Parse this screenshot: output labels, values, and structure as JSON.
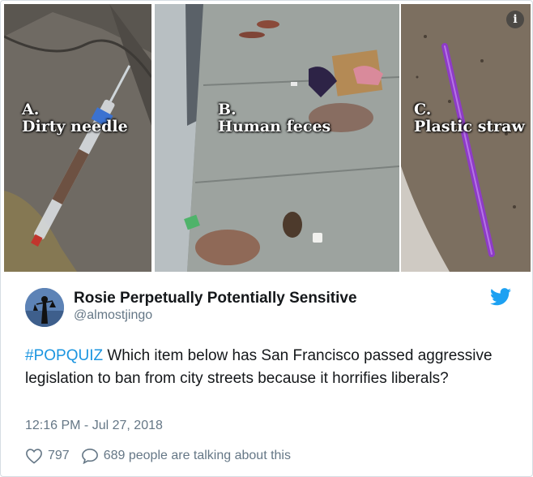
{
  "media": {
    "panels": [
      {
        "caption_letter": "A.",
        "caption_text": "Dirty needle"
      },
      {
        "caption_letter": "B.",
        "caption_text": "Human feces"
      },
      {
        "caption_letter": "C.",
        "caption_text": "Plastic straw"
      }
    ],
    "info_icon": "i"
  },
  "author": {
    "name": "Rosie Perpetually Potentially Sensitive",
    "handle": "@almostjingo"
  },
  "tweet": {
    "hashtag": "#POPQUIZ",
    "text": " Which item below has San Francisco passed aggressive legislation to ban from city streets because it horrifies liberals?",
    "timestamp": "12:16 PM - Jul 27, 2018"
  },
  "actions": {
    "likes": "797",
    "talking": "689 people are talking about this"
  },
  "icons": {
    "like": "heart-icon",
    "reply": "speech-bubble-icon",
    "brand": "twitter-bird-icon",
    "info": "info-icon"
  },
  "colors": {
    "link": "#1b95e0",
    "text": "#14171a",
    "secondary": "#657786",
    "straw": "#8e3bc7"
  }
}
